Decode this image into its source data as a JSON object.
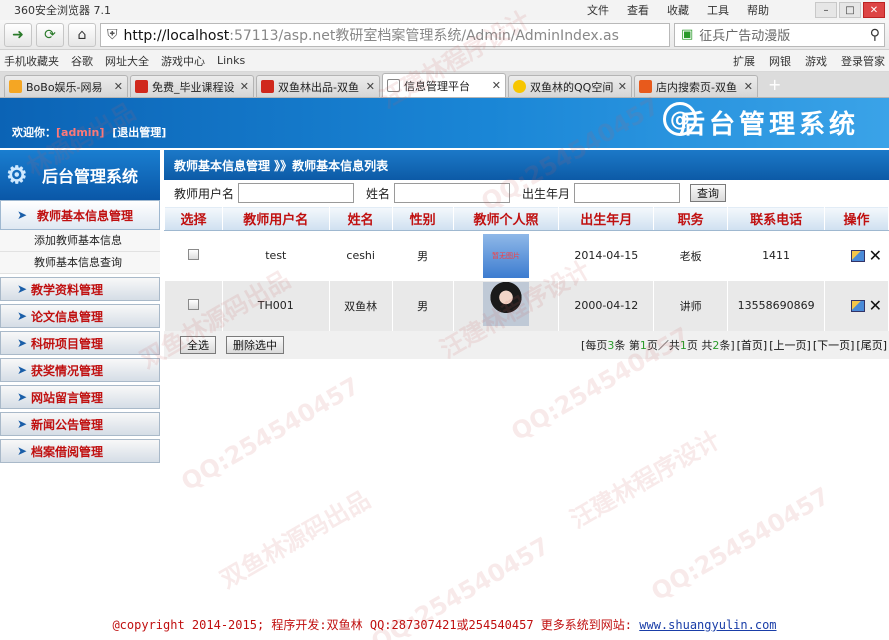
{
  "browser": {
    "title": "360安全浏览器 7.1",
    "menus": [
      "文件",
      "查看",
      "收藏",
      "工具",
      "帮助"
    ],
    "url_host": "http://localhost",
    "url_rest": ":57113/asp.net教研室档案管理系统/Admin/AdminIndex.as",
    "search_text": "征兵广告动漫版",
    "favorites": [
      "手机收藏夹",
      "谷歌",
      "网址大全",
      "游戏中心",
      "Links"
    ],
    "favorites_right": [
      "扩展",
      "网银",
      "游戏",
      "登录管家"
    ],
    "tabs": [
      {
        "label": "BoBo娱乐-网易",
        "color": "#f5a623"
      },
      {
        "label": "免费_毕业课程设",
        "color": "#d0281c"
      },
      {
        "label": "双鱼林出品-双鱼",
        "color": "#d0281c"
      },
      {
        "label": "信息管理平台",
        "color": "#ffffff"
      },
      {
        "label": "双鱼林的QQ空间",
        "color": "#f7c600"
      },
      {
        "label": "店内搜索页-双鱼",
        "color": "#e85a1c"
      }
    ]
  },
  "header": {
    "welcome": "欢迎你：",
    "user": "[admin]",
    "logout": "[退出管理]",
    "system_name": "后台管理系统",
    "logo_symbol": "@"
  },
  "sidebar": {
    "logo_text": "后台管理系统",
    "current_menu": "教师基本信息管理",
    "sub_items": [
      "添加教师基本信息",
      "教师基本信息查询"
    ],
    "menus": [
      "教学资料管理",
      "论文信息管理",
      "科研项目管理",
      "获奖情况管理",
      "网站留言管理",
      "新闻公告管理",
      "档案借阅管理"
    ]
  },
  "main": {
    "breadcrumb": "教师基本信息管理 》》教师基本信息列表",
    "filter": {
      "username_label": "教师用户名",
      "name_label": "姓名",
      "birth_label": "出生年月",
      "search_button": "查询"
    },
    "columns": [
      "选择",
      "教师用户名",
      "姓名",
      "性别",
      "教师个人照",
      "出生年月",
      "职务",
      "联系电话",
      "操作"
    ],
    "rows": [
      {
        "username": "test",
        "name": "ceshi",
        "gender": "男",
        "photo_text": "暂无图片",
        "birth": "2014-04-15",
        "post": "老板",
        "phone": "1411"
      },
      {
        "username": "TH001",
        "name": "双鱼林",
        "gender": "男",
        "photo_text": "",
        "birth": "2000-04-12",
        "post": "讲师",
        "phone": "13558690869"
      }
    ],
    "select_all": "全选",
    "delete_selected": "删除选中",
    "pager": {
      "prefix": "[每页",
      "per_page": "3",
      "mid1": "条 第",
      "current": "1",
      "mid2": "页／共",
      "total_pages": "1",
      "mid3": "页 共",
      "total": "2",
      "suffix": "条]",
      "first": "[首页]",
      "prev": "[上一页]",
      "next": "[下一页]",
      "last": "[尾页]"
    }
  },
  "footer": {
    "text": "@copyright 2014-2015; 程序开发:双鱼林  QQ:287307421或254540457  更多系统到网站:",
    "link": "www.shuangyulin.com"
  },
  "watermarks": [
    "林源码出品",
    "汪建林程序设计",
    "QQ:254540457",
    "双鱼林源码出品",
    "QQ:254540457",
    "汪建林程序设计",
    "QQ:254540457",
    "双鱼林源码出品",
    "QQ:254540457",
    "汪建林程序设计",
    "QQ:254540457"
  ]
}
